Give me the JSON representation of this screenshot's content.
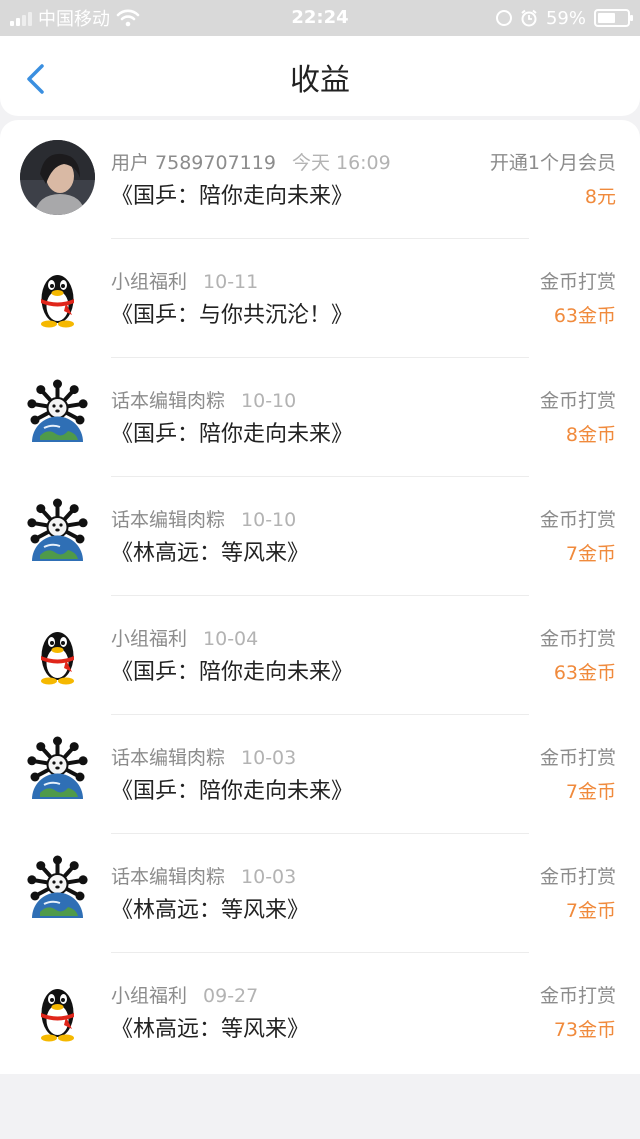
{
  "status_bar": {
    "carrier": "中国移动",
    "time": "22:24",
    "battery": "59%",
    "battery_level": 0.59,
    "icons": [
      "signal-icon",
      "wifi-icon",
      "rotation-lock-icon",
      "alarm-icon",
      "battery-icon"
    ]
  },
  "header": {
    "title": "收益",
    "back_icon": "chevron-left-icon",
    "accent_color": "#3a8fe0"
  },
  "colors": {
    "amount": "#f08a3c",
    "meta": "#8c8c8c",
    "text": "#222222"
  },
  "entries": [
    {
      "user": "用户 7589707119",
      "time": "今天 16:09",
      "book": "《国乒：陪你走向未来》",
      "type": "开通1个月会员",
      "amount": "8元",
      "avatar": "photo-avatar"
    },
    {
      "user": "小组福利",
      "time": "10-11",
      "book": "《国乒：与你共沉沦！》",
      "type": "金币打赏",
      "amount": "63金币",
      "avatar": "qq-penguin-avatar"
    },
    {
      "user": "话本编辑肉粽",
      "time": "10-10",
      "book": "《国乒：陪你走向未来》",
      "type": "金币打赏",
      "amount": "8金币",
      "avatar": "globe-dog-avatar"
    },
    {
      "user": "话本编辑肉粽",
      "time": "10-10",
      "book": "《林高远：等风来》",
      "type": "金币打赏",
      "amount": "7金币",
      "avatar": "globe-dog-avatar"
    },
    {
      "user": "小组福利",
      "time": "10-04",
      "book": "《国乒：陪你走向未来》",
      "type": "金币打赏",
      "amount": "63金币",
      "avatar": "qq-penguin-avatar"
    },
    {
      "user": "话本编辑肉粽",
      "time": "10-03",
      "book": "《国乒：陪你走向未来》",
      "type": "金币打赏",
      "amount": "7金币",
      "avatar": "globe-dog-avatar"
    },
    {
      "user": "话本编辑肉粽",
      "time": "10-03",
      "book": "《林高远：等风来》",
      "type": "金币打赏",
      "amount": "7金币",
      "avatar": "globe-dog-avatar"
    },
    {
      "user": "小组福利",
      "time": "09-27",
      "book": "《林高远：等风来》",
      "type": "金币打赏",
      "amount": "73金币",
      "avatar": "qq-penguin-avatar"
    }
  ]
}
